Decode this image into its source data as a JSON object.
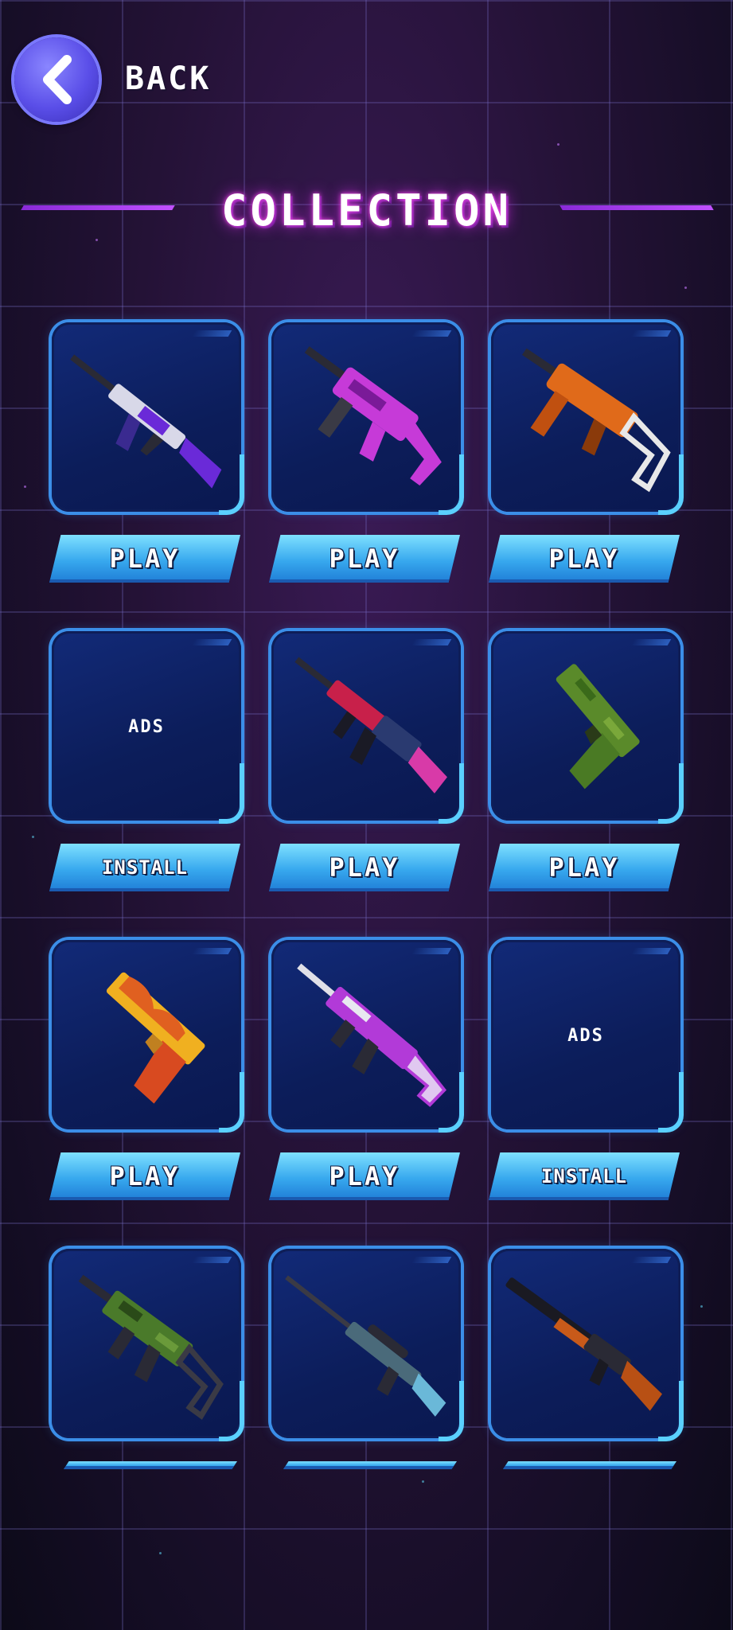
{
  "header": {
    "back_label": "BACK",
    "title": "COLLECTION"
  },
  "items": [
    {
      "icon": "ak47-purple-icon",
      "button": "PLAY"
    },
    {
      "icon": "vector-smg-purple-icon",
      "button": "PLAY"
    },
    {
      "icon": "ump-orange-icon",
      "button": "PLAY"
    },
    {
      "ads_label": "ADS",
      "button": "INSTALL"
    },
    {
      "icon": "m4-red-blue-icon",
      "button": "PLAY"
    },
    {
      "icon": "pistol-green-camo-icon",
      "button": "PLAY"
    },
    {
      "icon": "deagle-flame-icon",
      "button": "PLAY"
    },
    {
      "icon": "scar-purple-icon",
      "button": "PLAY"
    },
    {
      "ads_label": "ADS",
      "button": "INSTALL"
    },
    {
      "icon": "g36-green-camo-icon"
    },
    {
      "icon": "sniper-camo-icon"
    },
    {
      "icon": "shotgun-black-orange-icon"
    }
  ],
  "colors": {
    "accent_cyan": "#5ad0ff",
    "button_blue": "#37a8ee",
    "title_glow": "#ff4df0",
    "card_bg": "#0c1d5a"
  }
}
